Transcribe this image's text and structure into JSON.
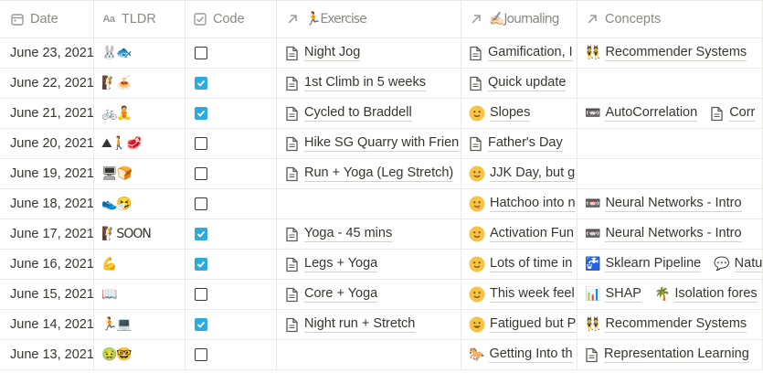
{
  "columns": {
    "date": "Date",
    "tldr": "TLDR",
    "code": "Code",
    "exercise": "🏃Exercise",
    "journaling": "✍🏻Journaling",
    "concepts": "Concepts"
  },
  "icons": {
    "date_header": "calendar-icon",
    "tldr_header": "text-icon",
    "code_header": "checkbox-icon",
    "relation_header": "arrow-up-right-icon",
    "page": "page-icon"
  },
  "colors": {
    "checkbox_checked": "#2eaadc",
    "border": "#e9e9e7",
    "header_text": "#8a8985"
  },
  "rows": [
    {
      "date": "June 23, 2021",
      "tldr": "🐰🐟",
      "code": false,
      "exercise": "Night Jog",
      "journaling": {
        "icon": "page",
        "text": "Gamification, I"
      },
      "concepts": [
        {
          "icon": "👯",
          "text": "Recommender Systems"
        }
      ]
    },
    {
      "date": "June 22, 2021",
      "tldr": "🧗🍝",
      "code": true,
      "exercise": "1st Climb in 5 weeks",
      "journaling": {
        "icon": "page",
        "text": "Quick update"
      },
      "concepts": []
    },
    {
      "date": "June 21, 2021",
      "tldr": "🚲🧘",
      "code": true,
      "exercise": "Cycled to Braddell",
      "journaling": {
        "icon": "smile",
        "text": "Slopes"
      },
      "concepts": [
        {
          "icon": "📼",
          "text": "AutoCorrelation"
        },
        {
          "icon": "page",
          "text": "Corr"
        }
      ]
    },
    {
      "date": "June 20, 2021",
      "tldr": "⛰🚶🥩",
      "code": false,
      "exercise": "Hike SG Quarry with Frien",
      "journaling": {
        "icon": "page",
        "text": "Father's Day"
      },
      "concepts": []
    },
    {
      "date": "June 19, 2021",
      "tldr": "🖥🍞",
      "code": false,
      "exercise": "Run + Yoga (Leg Stretch)",
      "journaling": {
        "icon": "smile",
        "text": "JJK Day, but g"
      },
      "concepts": []
    },
    {
      "date": "June 18, 2021",
      "tldr": "👟🤧",
      "code": false,
      "exercise": "",
      "journaling": {
        "icon": "tongue",
        "text": "Hatchoo into n"
      },
      "concepts": [
        {
          "icon": "📼",
          "text": "Neural Networks - Intro"
        }
      ]
    },
    {
      "date": "June 17, 2021",
      "tldr": "🧗SOON",
      "code": true,
      "exercise": "Yoga - 45 mins",
      "journaling": {
        "icon": "smile",
        "text": "Activation Fun"
      },
      "concepts": [
        {
          "icon": "📼",
          "text": "Neural Networks - Intro"
        }
      ]
    },
    {
      "date": "June 16, 2021",
      "tldr": "💪",
      "code": true,
      "exercise": "Legs + Yoga",
      "journaling": {
        "icon": "smile",
        "text": "Lots of time in"
      },
      "concepts": [
        {
          "icon": "🚰",
          "text": "Sklearn Pipeline"
        },
        {
          "icon": "💬",
          "text": "Natu"
        }
      ]
    },
    {
      "date": "June 15, 2021",
      "tldr": "📖",
      "code": false,
      "exercise": "Core + Yoga",
      "journaling": {
        "icon": "smile",
        "text": "This week feel"
      },
      "concepts": [
        {
          "icon": "📊",
          "text": "SHAP"
        },
        {
          "icon": "🌴",
          "text": "Isolation fores"
        }
      ]
    },
    {
      "date": "June 14, 2021",
      "tldr": "🏃💻",
      "code": true,
      "exercise": "Night run + Stretch",
      "journaling": {
        "icon": "happy",
        "text": "Fatigued but P"
      },
      "concepts": [
        {
          "icon": "👯",
          "text": "Recommender Systems"
        }
      ]
    },
    {
      "date": "June 13, 2021",
      "tldr": "🤢🤓",
      "code": false,
      "exercise": "",
      "journaling": {
        "icon": "🐎",
        "text": "Getting Into th"
      },
      "concepts": [
        {
          "icon": "page",
          "text": "Representation Learning"
        }
      ]
    }
  ]
}
